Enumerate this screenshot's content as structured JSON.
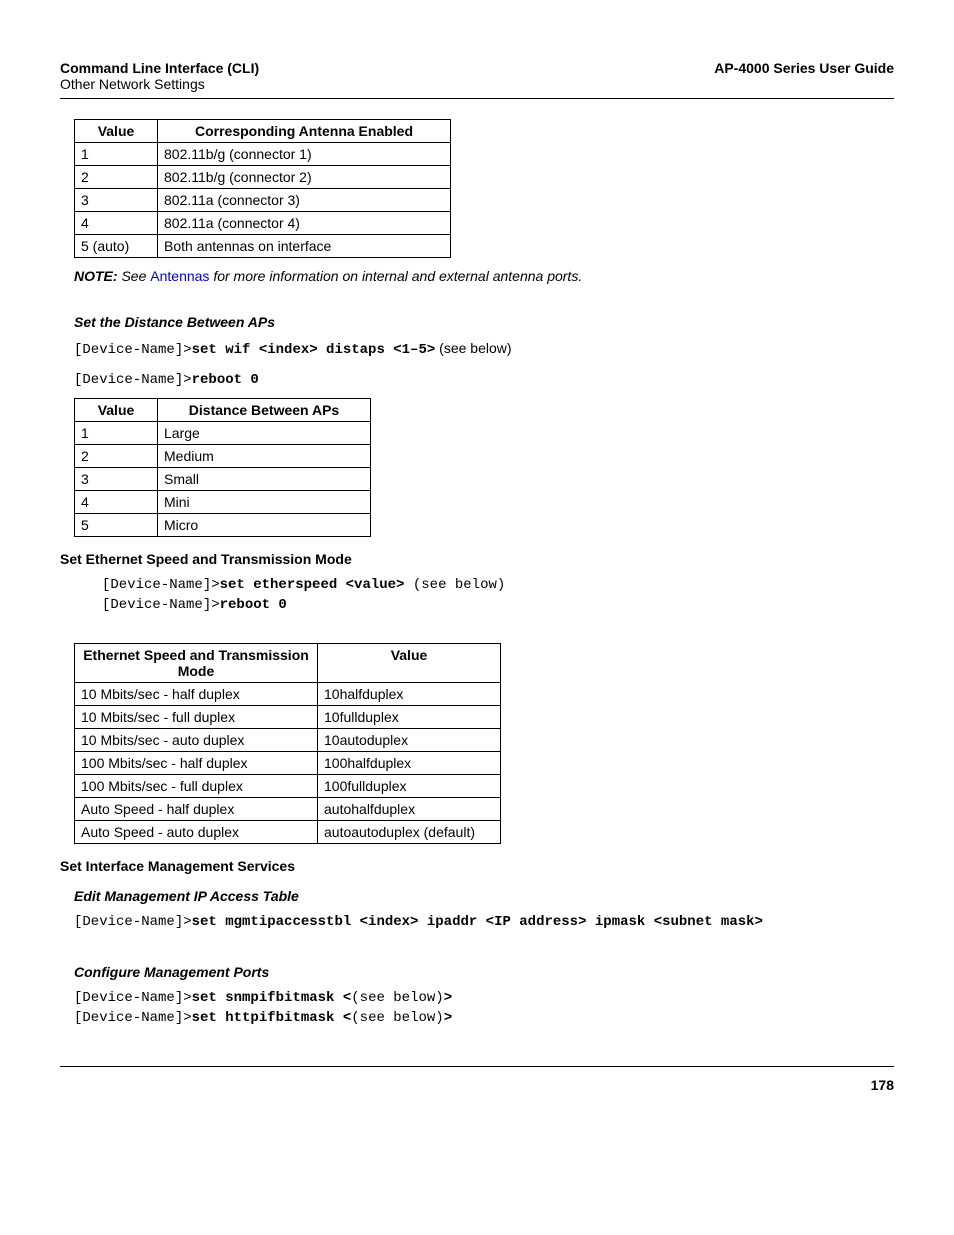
{
  "header": {
    "left": "Command Line Interface (CLI)",
    "right": "AP-4000 Series User Guide",
    "sub": "Other Network Settings"
  },
  "table1": {
    "headers": [
      "Value",
      "Corresponding Antenna Enabled"
    ],
    "rows": [
      [
        "1",
        "802.11b/g (connector 1)"
      ],
      [
        "2",
        "802.11b/g (connector 2)"
      ],
      [
        "3",
        "802.11a (connector 3)"
      ],
      [
        "4",
        "802.11a (connector 4)"
      ],
      [
        "5 (auto)",
        "Both antennas on interface"
      ]
    ]
  },
  "note": {
    "label": "NOTE:",
    "pre": "  See ",
    "link": "Antennas",
    "post": " for more information on internal and external antenna ports."
  },
  "sec1": {
    "title": "Set the Distance Between APs",
    "line1_pre": "[Device-Name]>",
    "line1_cmd": "set wif <index> distaps <1–5>",
    "line1_post": " (see below)",
    "line2_pre": "[Device-Name]>",
    "line2_cmd": "reboot 0"
  },
  "table2": {
    "headers": [
      "Value",
      "Distance Between APs"
    ],
    "rows": [
      [
        "1",
        "Large"
      ],
      [
        "2",
        "Medium"
      ],
      [
        "3",
        "Small"
      ],
      [
        "4",
        "Mini"
      ],
      [
        "5",
        "Micro"
      ]
    ]
  },
  "sec2": {
    "title": "Set Ethernet Speed and Transmission Mode",
    "line1_pre": "[Device-Name]>",
    "line1_cmd": "set etherspeed <value>",
    "line1_post": " (see below)",
    "line2_pre": "[Device-Name]>",
    "line2_cmd": "reboot 0"
  },
  "table3": {
    "headers": [
      "Ethernet Speed and Transmission Mode",
      "Value"
    ],
    "rows": [
      [
        "10 Mbits/sec - half duplex",
        "10halfduplex"
      ],
      [
        "10 Mbits/sec - full duplex",
        "10fullduplex"
      ],
      [
        "10 Mbits/sec - auto duplex",
        "10autoduplex"
      ],
      [
        "100 Mbits/sec - half duplex",
        "100halfduplex"
      ],
      [
        "100 Mbits/sec - full duplex",
        "100fullduplex"
      ],
      [
        "Auto Speed - half duplex",
        "autohalfduplex"
      ],
      [
        "Auto Speed - auto duplex",
        "autoautoduplex (default)"
      ]
    ]
  },
  "sec3": {
    "title": "Set Interface Management Services",
    "sub1": "Edit Management IP Access Table",
    "line1_pre": "[Device-Name]>",
    "line1_cmd": "set mgmtipaccesstbl <index> ipaddr <IP address> ipmask <subnet mask>",
    "sub2": "Configure Management Ports",
    "line2_pre": "[Device-Name]>",
    "line2_cmd_a": "set snmpifbitmask <",
    "line2_mid": "(see below)",
    "line2_cmd_b": ">",
    "line3_pre": "[Device-Name]>",
    "line3_cmd_a": "set httpifbitmask <",
    "line3_mid": "(see below)",
    "line3_cmd_b": ">"
  },
  "page": "178"
}
